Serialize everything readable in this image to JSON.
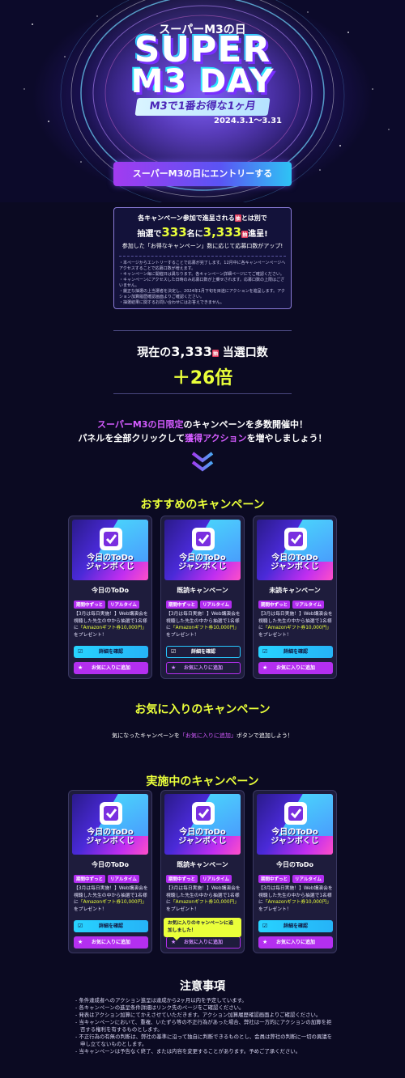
{
  "hero": {
    "subtitle": "スーパーM3の日",
    "title_line1": "SUPER",
    "title_line2": "M3 DAY",
    "tagline": "M3で1番お得な1ヶ月",
    "dates": "2024.3.1～3.31"
  },
  "entry_button": "スーパーM3の日にエントリーする",
  "info": {
    "line1_pre": "各キャンペーン参加で進呈される",
    "line1_badge": "抽",
    "line1_post": "とは別で",
    "line2_a": "抽選で",
    "line2_num1": "333",
    "line2_b": "名に",
    "line2_num2": "3,333",
    "line2_badge": "抽",
    "line2_c": "進呈!",
    "line3": "参加した「お得なキャンペーン」数に応じて応募口数がアップ!",
    "notes": [
      "本ページからエントリーすることで応募が完了します。12月中に各キャンペーンページへアクセスすることで応募口数が増えます。",
      "キャンペーン毎に開催日は異なります。各キャンペーン詳細ページにてご確認ください。",
      "キャンペーンにアクセスした日時のみ応募口数が上乗せされます。応募口数の上限はございません。",
      "厳正な抽選の上当選者を決定し、2024年1月下旬を目途にアクションを進呈します。アクション加算履歴確認画面よりご確認ください。",
      "抽選結果に関するお問い合わせにはお答えできません。"
    ]
  },
  "count": {
    "pre": "現在の",
    "num": "3,333",
    "badge": "抽",
    "post": "当選口数",
    "multiplier": "＋26倍"
  },
  "promo": {
    "hl1": "スーパーM3の日限定",
    "t1": "のキャンペーンを多数開催中！",
    "t2a": "パネルを全部クリックして",
    "hl2": "獲得アクション",
    "t2b": "を増やしましょう！"
  },
  "sections": {
    "recommended": "おすすめのキャンペーン",
    "favorites": "お気に入りのキャンペーン",
    "active": "実施中のキャンペーン",
    "notes": "注意事項"
  },
  "favorites_note": {
    "pre": "気になったキャンペーンを",
    "hl": "「お気に入りに追加」",
    "post": "ボタンで追加しよう！"
  },
  "card_common": {
    "thumb_line1": "今日のToDo",
    "thumb_line2": "ジャンボくじ",
    "tag1": "期間中ずっと",
    "tag2": "リアルタイム",
    "desc_pre": "【3月は毎日実施！】Web講演会を視聴した先生の中から抽選で1名様に",
    "desc_hl": "「Amazonギフト券10,000円」",
    "desc_post": "をプレゼント！",
    "detail_button": "詳細を確認",
    "fav_button": "お気に入りに追加"
  },
  "recommended_cards": [
    {
      "name": "今日のToDo"
    },
    {
      "name": "既読キャンペーン"
    },
    {
      "name": "未読キャンペーン"
    }
  ],
  "active_cards": [
    {
      "name": "今日のToDo"
    },
    {
      "name": "既読キャンペーン"
    },
    {
      "name": "今日のToDo"
    }
  ],
  "tooltip": "お気に入りのキャンペーンに追加しました！",
  "notes": [
    "条件達成者へのアクション進呈は達成から2ヶ月以内を予定しています。",
    "各キャンペーンの進呈条件詳細はリンク先のページをご確認ください。",
    "発表はアクション加算にてかえさせていただきます。アクション加算履歴確認画面よりご確認ください。",
    "当キャンペーンにおいて、重複、いたずら等の不正行為があった場合、弊社は一方的にアクションの加算を拒否する権利を有するものとします。",
    "不正行為の有無の判断は、弊社の基準に沿って独自に判断できるものとし、会員は弊社の判断に一切の異議を申し立てないものとします。",
    "当キャンペーンは予告なく終了、または内容を変更することがあります。予めご了承ください。"
  ],
  "colors": {
    "background": "#0b0a22",
    "accent_yellow": "#eaff3a",
    "accent_purple": "#b42ff0",
    "accent_cyan": "#27d3ff"
  }
}
